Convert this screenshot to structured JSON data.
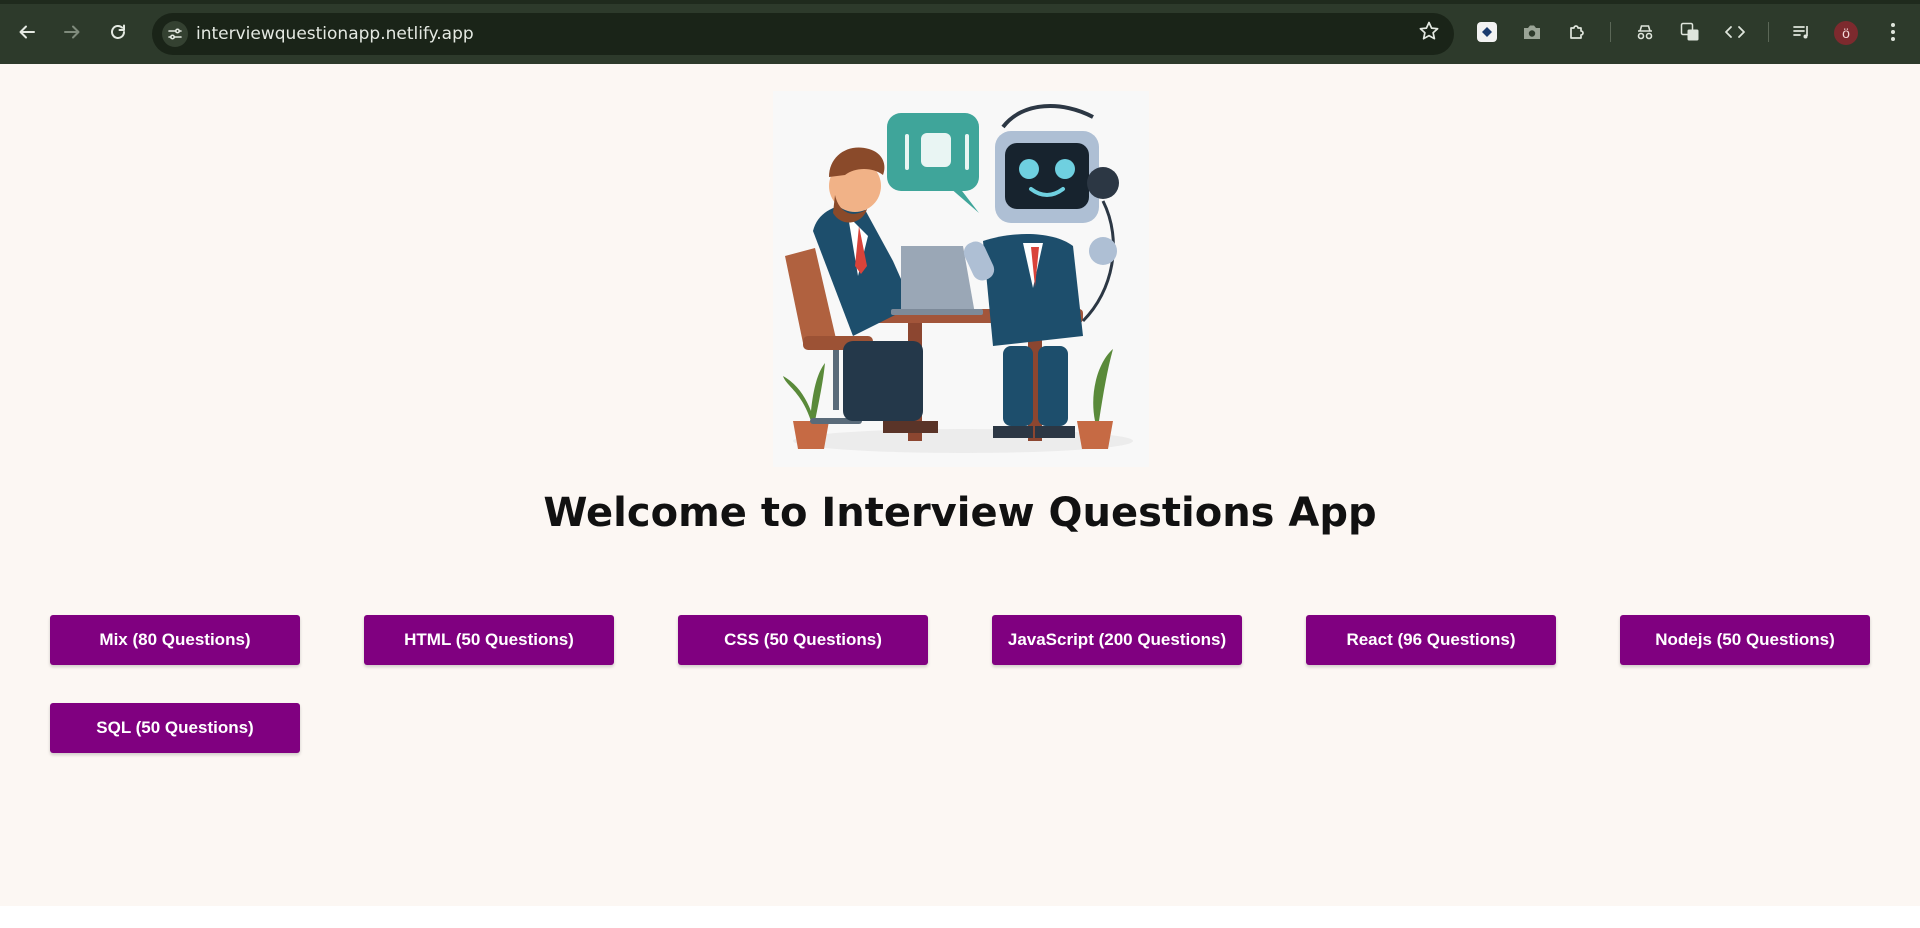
{
  "browser": {
    "url": "interviewquestionapp.netlify.app",
    "profile_initial": "ö",
    "icons": {
      "back": "arrow-left-icon",
      "forward": "arrow-right-icon",
      "reload": "reload-icon",
      "site_info": "tune-icon",
      "bookmark": "star-icon",
      "menu": "more-vert-icon"
    }
  },
  "page": {
    "title": "Welcome to Interview Questions App",
    "illustration": "interview-illustration",
    "button_color": "#800080",
    "background": "#fcf7f3",
    "buttons": [
      {
        "label": "Mix (80 Questions)"
      },
      {
        "label": "HTML (50 Questions)"
      },
      {
        "label": "CSS (50 Questions)"
      },
      {
        "label": "JavaScript (200 Questions)"
      },
      {
        "label": "React (96 Questions)"
      },
      {
        "label": "Nodejs (50 Questions)"
      },
      {
        "label": "SQL (50 Questions)"
      }
    ]
  }
}
